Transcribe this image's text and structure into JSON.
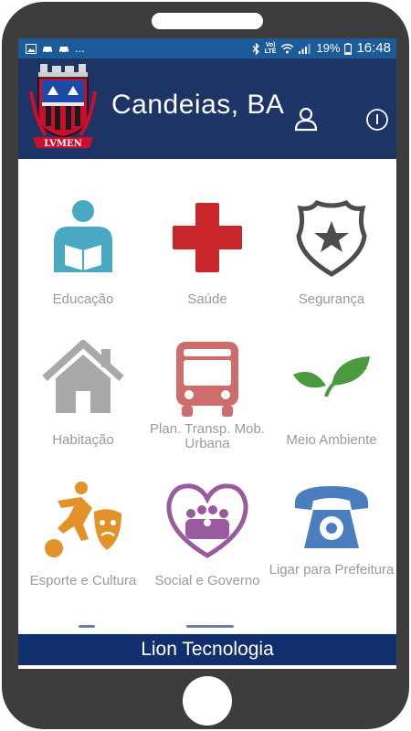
{
  "status_bar": {
    "notifications": [
      "image-icon",
      "car-icon",
      "car-icon"
    ],
    "overflow": "...",
    "network_top": "Vo)",
    "network_bottom": "LTE",
    "battery": "19%",
    "time": "16:48"
  },
  "header": {
    "title": "Candeias, BA",
    "crest_motto": "LVMEN"
  },
  "menu": {
    "items": [
      {
        "label": "Educação",
        "icon": "reading-person-icon"
      },
      {
        "label": "Saúde",
        "icon": "red-cross-icon"
      },
      {
        "label": "Segurança",
        "icon": "police-badge-icon"
      },
      {
        "label": "Habitação",
        "icon": "house-icon"
      },
      {
        "label": "Plan. Transp. Mob. Urbana",
        "icon": "bus-icon"
      },
      {
        "label": "Meio Ambiente",
        "icon": "leaves-icon"
      },
      {
        "label": "Esporte e Cultura",
        "icon": "sport-theatre-icon"
      },
      {
        "label": "Social e Governo",
        "icon": "community-heart-icon"
      },
      {
        "label": "Ligar para Prefeitura",
        "icon": "telephone-icon"
      }
    ]
  },
  "footer": {
    "text": "Lion Tecnologia"
  },
  "colors": {
    "header_bg": "#1d3466",
    "status_bg": "#1d5a9a",
    "footer_bg": "#102f6c",
    "label_gray": "#9a9a9a"
  }
}
